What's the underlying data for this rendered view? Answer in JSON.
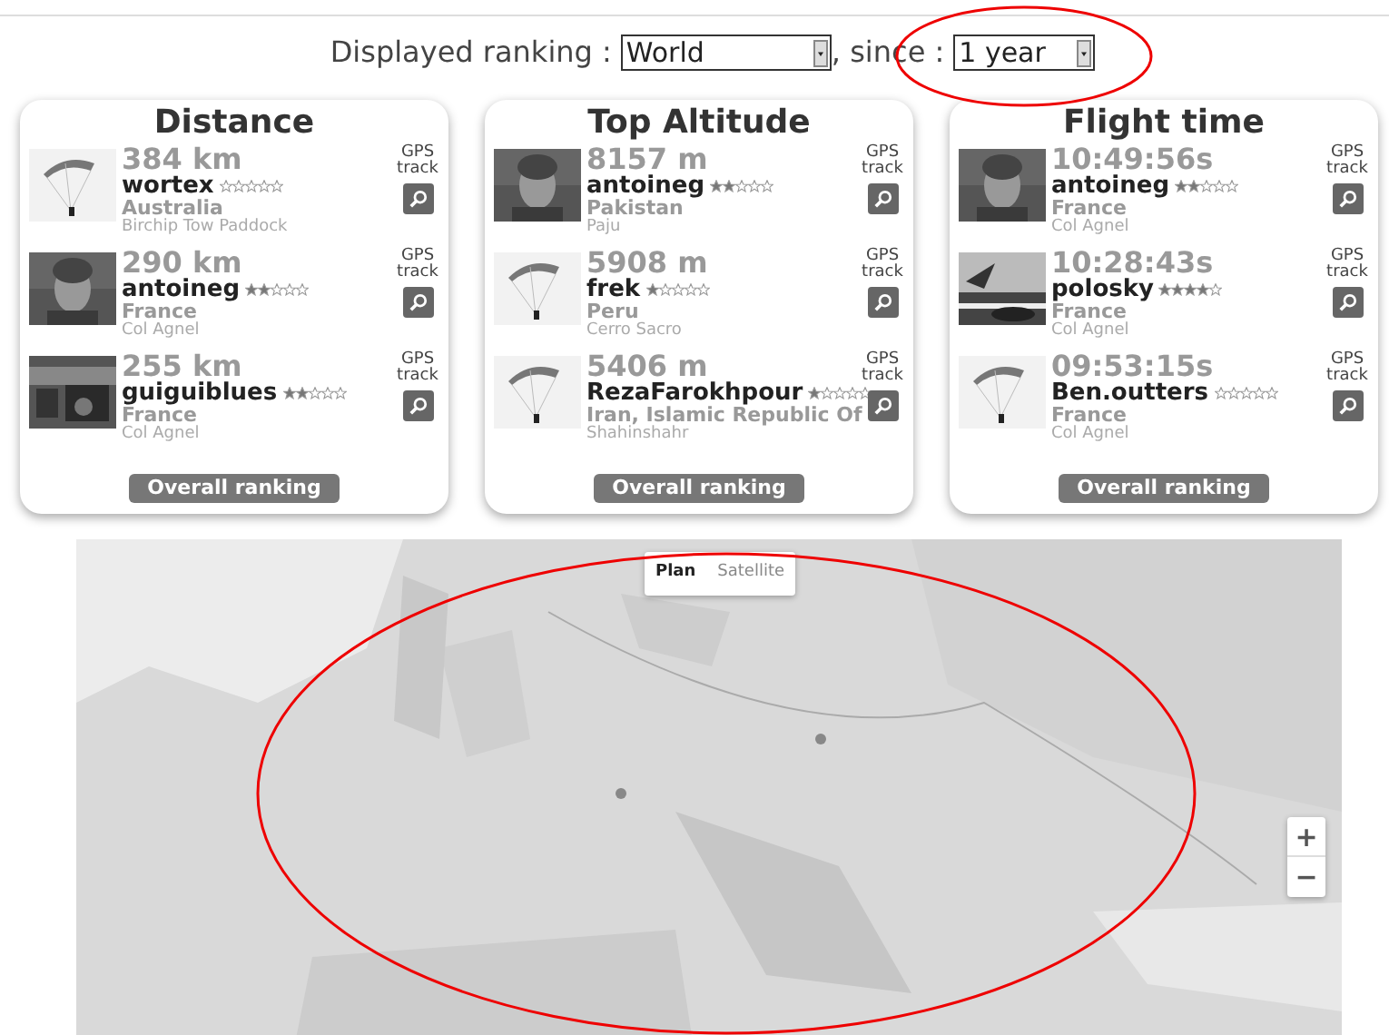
{
  "filter": {
    "label": "Displayed ranking :",
    "ranking": "World",
    "since_label": ", since :",
    "since": "1 year"
  },
  "cards": [
    {
      "title": "Distance",
      "button": "Overall ranking",
      "entries": [
        {
          "value": "384 km",
          "pilot": "wortex",
          "stars": 0,
          "country": "Australia",
          "site": "Birchip Tow Paddock",
          "gps": "GPS track"
        },
        {
          "value": "290 km",
          "pilot": "antoineg",
          "stars": 2,
          "country": "France",
          "site": "Col Agnel",
          "gps": "GPS track"
        },
        {
          "value": "255 km",
          "pilot": "guiguiblues",
          "stars": 2,
          "country": "France",
          "site": "Col Agnel",
          "gps": "GPS track"
        }
      ]
    },
    {
      "title": "Top Altitude",
      "button": "Overall ranking",
      "entries": [
        {
          "value": "8157 m",
          "pilot": "antoineg",
          "stars": 2,
          "country": "Pakistan",
          "site": "Paju",
          "gps": "GPS track"
        },
        {
          "value": "5908 m",
          "pilot": "frek",
          "stars": 1,
          "country": "Peru",
          "site": "Cerro Sacro",
          "gps": "GPS track"
        },
        {
          "value": "5406 m",
          "pilot": "RezaFarokhpour",
          "stars": 1,
          "country": "Iran, Islamic Republic Of",
          "site": "Shahinshahr",
          "gps": "GPS track"
        }
      ]
    },
    {
      "title": "Flight time",
      "button": "Overall ranking",
      "entries": [
        {
          "value": "10:49:56s",
          "pilot": "antoineg",
          "stars": 2,
          "country": "France",
          "site": "Col Agnel",
          "gps": "GPS track"
        },
        {
          "value": "10:28:43s",
          "pilot": "polosky",
          "stars": 4,
          "country": "France",
          "site": "Col Agnel",
          "gps": "GPS track"
        },
        {
          "value": "09:53:15s",
          "pilot": "Ben.outters",
          "stars": 0,
          "country": "France",
          "site": "Col Agnel",
          "gps": "GPS track"
        }
      ]
    }
  ],
  "map": {
    "map_types": [
      {
        "label": "Plan",
        "selected": true
      },
      {
        "label": "Satellite",
        "selected": false
      }
    ],
    "zoom": [
      "+",
      "−"
    ]
  }
}
